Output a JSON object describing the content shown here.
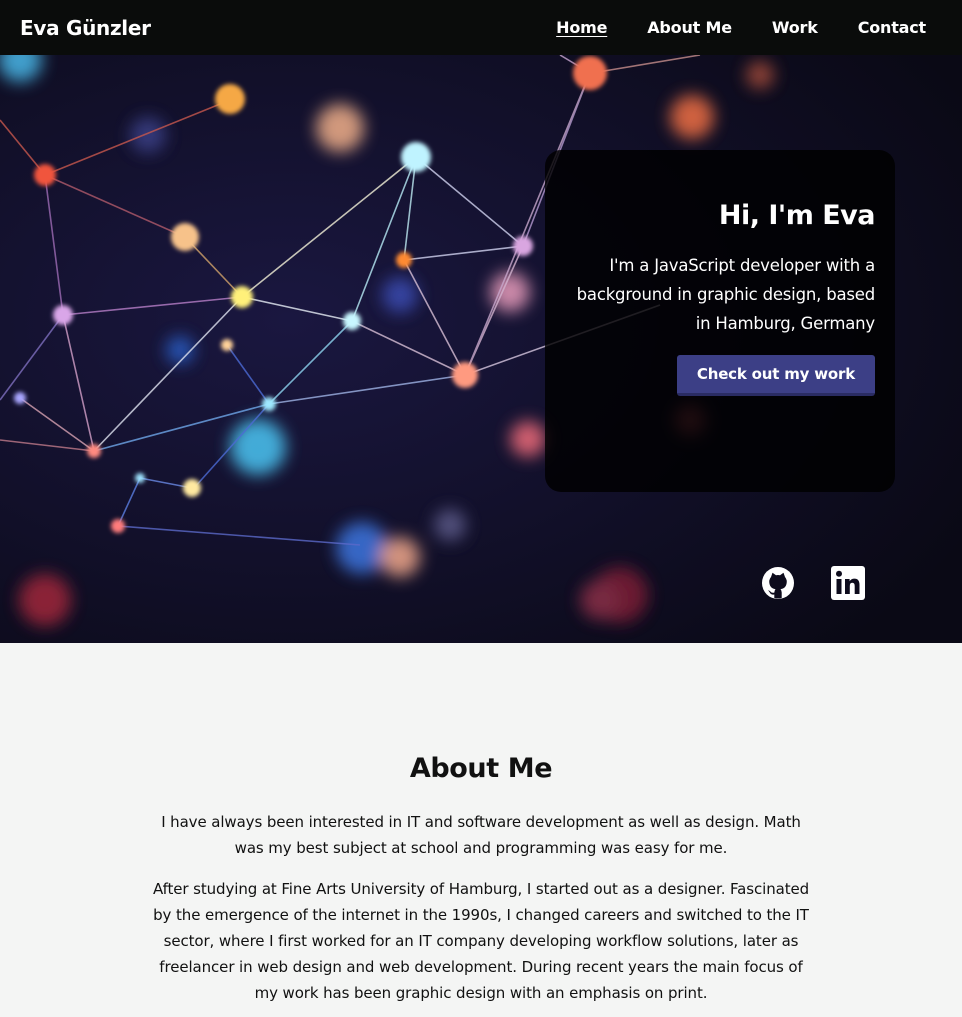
{
  "nav": {
    "brand": "Eva Günzler",
    "items": [
      {
        "label": "Home",
        "active": true
      },
      {
        "label": "About Me",
        "active": false
      },
      {
        "label": "Work",
        "active": false
      },
      {
        "label": "Contact",
        "active": false
      }
    ]
  },
  "hero": {
    "title": "Hi, I'm Eva",
    "intro": "I'm a JavaScript developer with a background in graphic design, based in Hamburg, Germany",
    "cta_label": "Check out my work",
    "social": [
      {
        "icon": "github-icon"
      },
      {
        "icon": "linkedin-icon"
      }
    ]
  },
  "about": {
    "title": "About Me",
    "paragraphs": [
      "I have always been interested in IT and software development as well as design. Math was my best subject at school and programming was easy for me.",
      "After studying at Fine Arts University of Hamburg, I started out as a designer. Fascinated by the emergence of the internet in the 1990s, I changed careers and switched to the IT sector, where I first worked for an IT company developing workflow solutions, later as freelancer in web design and web development. During recent years the main focus of my work has been graphic design with an emphasis on print."
    ]
  },
  "colors": {
    "nav_bg": "#0a0c0b",
    "cta_bg": "#3c3f86",
    "hero_bg": "#0d0b1c",
    "section_bg": "#f4f5f4"
  }
}
